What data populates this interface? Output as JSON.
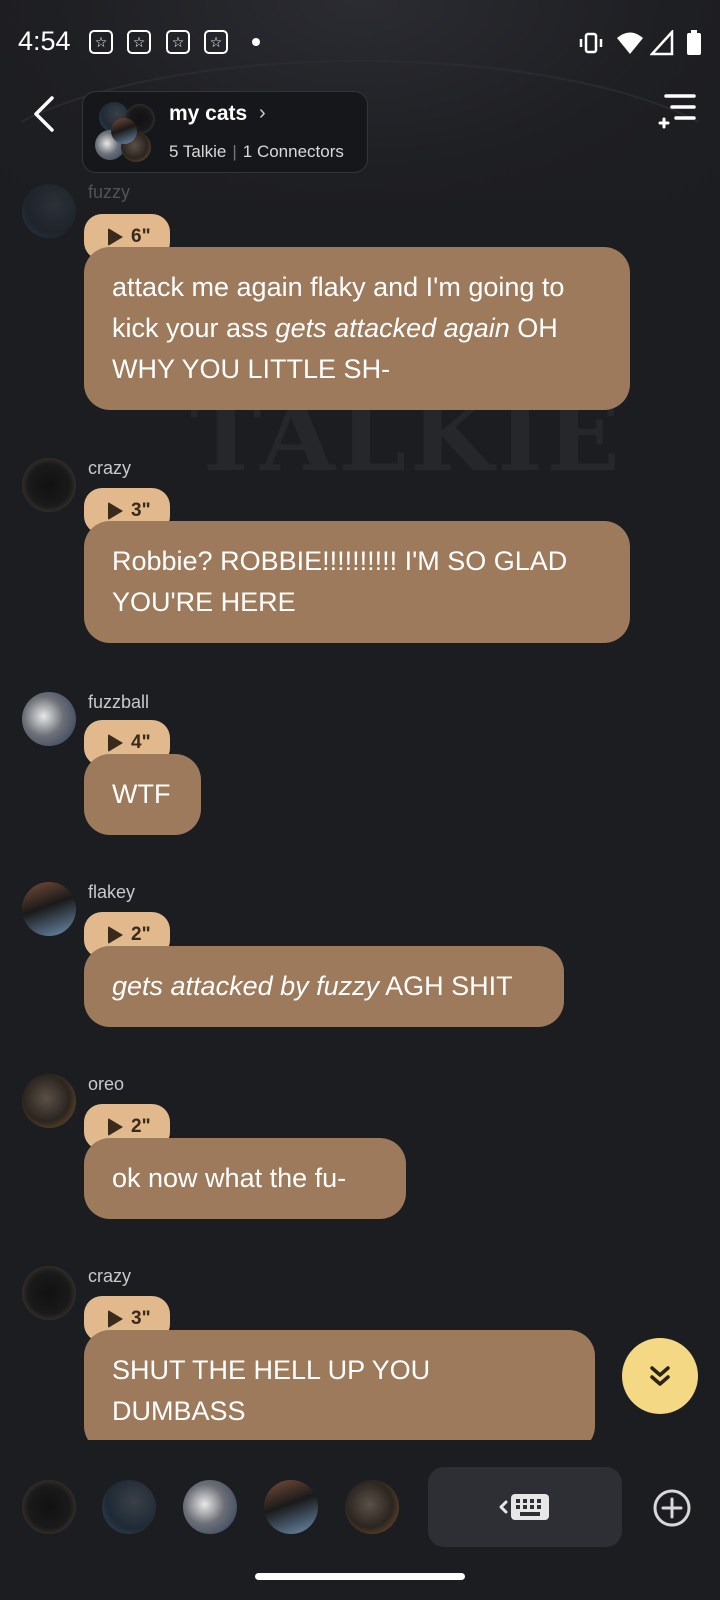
{
  "status_bar": {
    "time": "4:54",
    "notification_icons": [
      "star-notification-icon",
      "star-notification-icon",
      "star-notification-icon",
      "star-notification-icon"
    ]
  },
  "header": {
    "group_name": "my cats",
    "talkie_count": "5 Talkie",
    "connectors_count": "1 Connectors"
  },
  "watermark": "TALKIE",
  "messages": [
    {
      "sender": "fuzzy",
      "duration": "6\"",
      "text_parts": [
        {
          "t": "attack me again flaky and I'm going to kick your ass ",
          "i": false
        },
        {
          "t": "gets attacked again",
          "i": true
        },
        {
          "t": " OH WHY YOU LITTLE SH-",
          "i": false
        }
      ]
    },
    {
      "sender": "crazy",
      "duration": "3\"",
      "text_parts": [
        {
          "t": "Robbie? ROBBIE!!!!!!!!!! I'M SO GLAD YOU'RE HERE",
          "i": false
        }
      ]
    },
    {
      "sender": "fuzzball",
      "duration": "4\"",
      "text_parts": [
        {
          "t": "WTF",
          "i": false
        }
      ]
    },
    {
      "sender": "flakey",
      "duration": "2\"",
      "text_parts": [
        {
          "t": "gets attacked by fuzzy",
          "i": true
        },
        {
          "t": " AGH SHIT",
          "i": false
        }
      ]
    },
    {
      "sender": "oreo",
      "duration": "2\"",
      "text_parts": [
        {
          "t": "ok now what the fu-",
          "i": false
        }
      ]
    },
    {
      "sender": "crazy",
      "duration": "3\"",
      "text_parts": [
        {
          "t": "SHUT THE HELL UP YOU DUMBASS",
          "i": false
        }
      ]
    }
  ],
  "colors": {
    "background": "#1c1d21",
    "bubble": "#9c7a5b",
    "duration_pill": "#e2b88d",
    "scroll_button": "#f4d884"
  }
}
